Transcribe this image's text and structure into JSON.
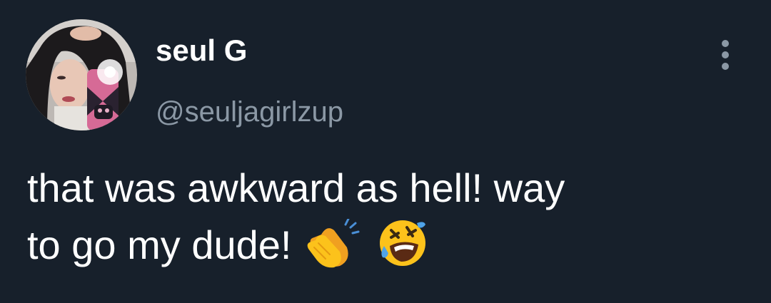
{
  "user": {
    "display_name": "seul G",
    "handle": "@seuljagirlzup"
  },
  "tweet": {
    "line1": "that was awkward as hell! way",
    "line2": "to go my dude!",
    "emojis": [
      "clapping-hands-emoji",
      "rolling-on-floor-laughing-emoji"
    ]
  },
  "menu": {
    "icon": "more-options-vertical-icon"
  },
  "colors": {
    "background": "#17202b",
    "primary_text": "#ffffff",
    "secondary_text": "#8b98a5"
  }
}
